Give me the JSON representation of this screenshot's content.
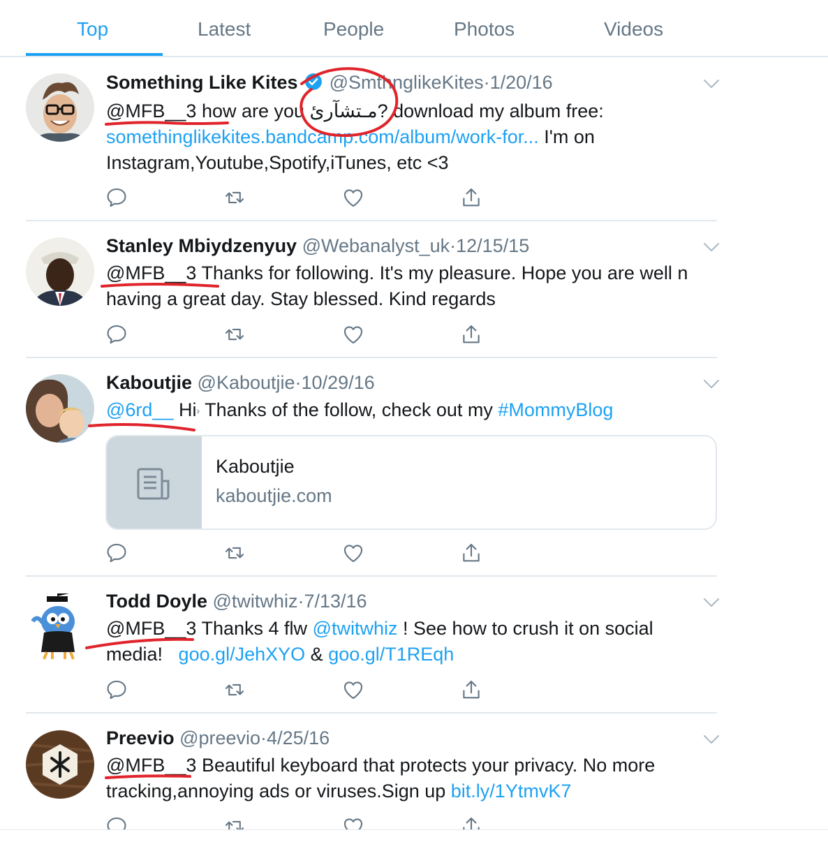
{
  "tabs": [
    "Top",
    "Latest",
    "People",
    "Photos",
    "Videos"
  ],
  "active_tab": "Top",
  "tweets": [
    {
      "name": "Something Like Kites",
      "handle": "@SmthnglikeKites",
      "date": "1/20/16",
      "verified": true,
      "mention": "@MFB__3",
      "text_1": " how are you ",
      "arabic": "مـتشآرئ",
      "text_2": "? download my album free:",
      "link": "somethinglikekites.bandcamp.com/album/work-for...",
      "text_3": " I'm on",
      "text_4": "Instagram,Youtube,Spotify,iTunes, etc <3"
    },
    {
      "name": "Stanley Mbiydzenyuy",
      "handle": "@Webanalyst_uk",
      "date": "12/15/15",
      "mention": "@MFB__3",
      "text_1": " Thanks for following. It's my pleasure. Hope you are well n",
      "text_2": "having a great day. Stay blessed. Kind regards"
    },
    {
      "name": "Kaboutjie",
      "handle": "@Kaboutjie",
      "date": "10/29/16",
      "mention": "@6rd__",
      "text_1": " Hi",
      "text_2": " Thanks of the follow, check out my ",
      "hashtag": "#MommyBlog",
      "card_title": "Kaboutjie",
      "card_domain": "kaboutjie.com"
    },
    {
      "name": "Todd Doyle",
      "handle": "@twitwhiz",
      "date": "7/13/16",
      "mention": "@MFB__3",
      "text_1": " Thanks 4 flw ",
      "mention_2": "@twitwhiz",
      "text_2": " ! See how to crush it on social",
      "text_3": "media!   ",
      "link_1": "goo.gl/JehXYO",
      "text_4": " & ",
      "link_2": "goo.gl/T1REqh"
    },
    {
      "name": "Preevio",
      "handle": "@preevio",
      "date": "4/25/16",
      "mention": "@MFB__3",
      "text_1": " Beautiful keyboard that protects your privacy. No more",
      "text_2": "tracking,annoying ads or viruses.Sign up ",
      "link": "bit.ly/1YtmvK7"
    }
  ],
  "dot": "·",
  "colors": {
    "accent": "#1da1f2",
    "muted": "#657786",
    "annotation": "#e0242b"
  },
  "icons": [
    "reply-icon",
    "retweet-icon",
    "like-icon",
    "share-icon",
    "chevron-down-icon",
    "verified-icon",
    "document-icon"
  ]
}
